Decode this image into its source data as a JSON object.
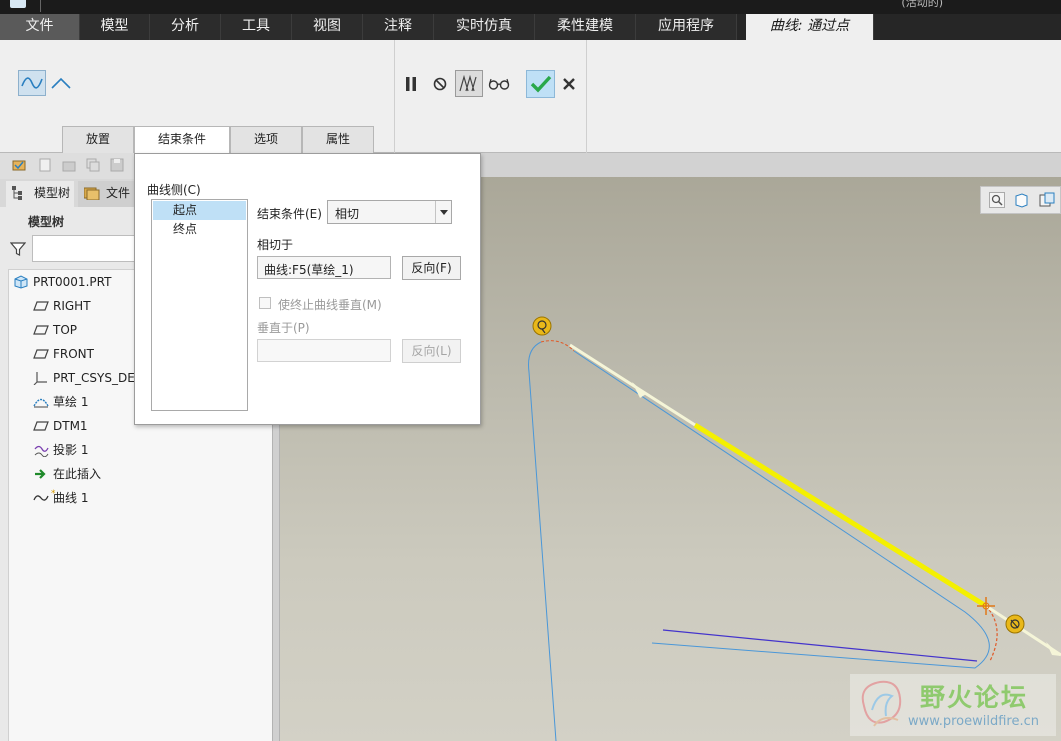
{
  "window": {
    "title_fragment": "(活动的)"
  },
  "menu": {
    "tabs": [
      {
        "label": "文件"
      },
      {
        "label": "模型"
      },
      {
        "label": "分析"
      },
      {
        "label": "工具"
      },
      {
        "label": "视图"
      },
      {
        "label": "注释"
      },
      {
        "label": "实时仿真"
      },
      {
        "label": "柔性建模"
      },
      {
        "label": "应用程序"
      },
      {
        "label": "曲线: 通过点"
      }
    ]
  },
  "ribbon": {
    "subtabs": [
      {
        "label": "放置"
      },
      {
        "label": "结束条件"
      },
      {
        "label": "选项"
      },
      {
        "label": "属性"
      }
    ],
    "icons": [
      "spline-curve-icon",
      "arc-curve-icon",
      "pause-icon",
      "cancel-circle-icon",
      "preview-toggle-icon",
      "glasses-icon",
      "ok-check-icon",
      "close-x-icon"
    ]
  },
  "left_panel": {
    "tabs": [
      {
        "label": "模型树"
      },
      {
        "label": "文件夹"
      }
    ],
    "heading": "模型树",
    "filter_placeholder": "",
    "tree": [
      {
        "label": "PRT0001.PRT",
        "icon": "part-icon"
      },
      {
        "label": "RIGHT",
        "icon": "datum-plane-icon"
      },
      {
        "label": "TOP",
        "icon": "datum-plane-icon"
      },
      {
        "label": "FRONT",
        "icon": "datum-plane-icon"
      },
      {
        "label": "PRT_CSYS_DEF",
        "icon": "csys-icon"
      },
      {
        "label": "草绘 1",
        "icon": "sketch-icon"
      },
      {
        "label": "DTM1",
        "icon": "datum-plane-icon"
      },
      {
        "label": "投影 1",
        "icon": "projection-icon"
      },
      {
        "label": "在此插入",
        "icon": "insert-arrow-icon"
      },
      {
        "label": "曲线 1",
        "icon": "curve-icon"
      }
    ]
  },
  "popup": {
    "side_label": "曲线侧(C)",
    "side_items": [
      {
        "label": "起点"
      },
      {
        "label": "终点"
      }
    ],
    "end_condition_label": "结束条件(E)",
    "end_condition_value": "相切",
    "tangent_to_label": "相切于",
    "tangent_to_value": "曲线:F5(草绘_1)",
    "flip_label": "反向(F)",
    "perpendicular_check_label": "使终止曲线垂直(M)",
    "perpendicular_to_label": "垂直于(P)",
    "perpendicular_to_value": "",
    "flip2_label": "反向(L)"
  },
  "watermark": {
    "text": "野火论坛",
    "url": "www.proewildfire.cn"
  },
  "colors": {
    "menu_bg": "#262626",
    "ribbon_bg": "#efefef",
    "viewport_top": "#a8a596",
    "viewport_bottom": "#d3d1c6",
    "curve_yellow": "#f4f000",
    "selection_blue": "#bfe0f6",
    "ok_green": "#2aa84a"
  }
}
